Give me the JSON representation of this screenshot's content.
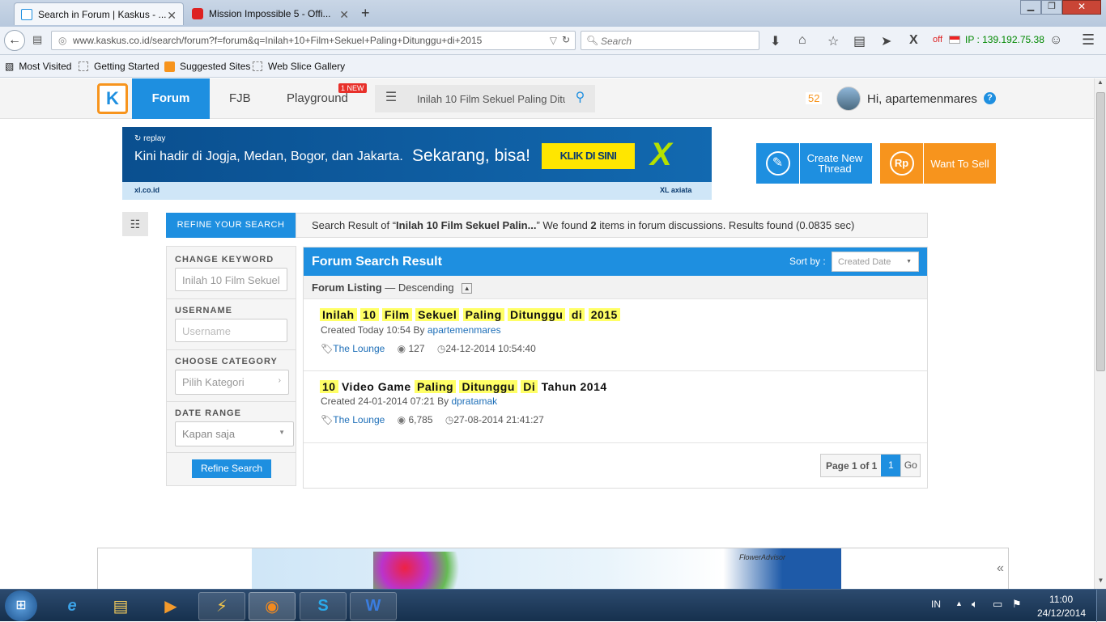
{
  "browser": {
    "tabs": [
      {
        "title": "Search in Forum | Kaskus - ...",
        "active": true
      },
      {
        "title": "Mission Impossible 5 - Offi...",
        "active": false
      }
    ],
    "new_tab_label": "+",
    "url": "www.kaskus.co.id/search/forum?f=forum&q=Inilah+10+Film+Sekuel+Paling+Ditunggu+di+2015",
    "search_placeholder": "Search",
    "vpn_status": "off",
    "ip_label": "IP : 139.192.75.38",
    "bookmarks": [
      "Most Visited",
      "Getting Started",
      "Suggested Sites",
      "Web Slice Gallery"
    ]
  },
  "site": {
    "nav": {
      "forum": "Forum",
      "fjb": "FJB",
      "playground": "Playground",
      "new_badge": "1 NEW",
      "search_value": "Inilah 10 Film Sekuel Paling Ditu"
    },
    "notification_count": "52",
    "greeting": "Hi, apartemenmares",
    "help_icon": "?"
  },
  "banner": {
    "brand_small": "replay",
    "headline": "Kini hadir di Jogja, Medan, Bogor, dan Jakarta.",
    "headline_big": "Sekarang, bisa!",
    "cta": "KLIK DI SINI",
    "site": "xl.co.id",
    "sponsor": "XL axiata"
  },
  "actions": {
    "create_thread": "Create New Thread",
    "want_to_sell": "Want To Sell",
    "rp_icon": "Rp"
  },
  "refine": {
    "tab_label": "REFINE YOUR SEARCH",
    "change_keyword_label": "CHANGE KEYWORD",
    "keyword_value": "Inilah 10 Film Sekuel",
    "username_label": "USERNAME",
    "username_placeholder": "Username",
    "category_label": "CHOOSE CATEGORY",
    "category_value": "Pilih Kategori",
    "date_label": "DATE RANGE",
    "date_value": "Kapan saja",
    "button": "Refine Search"
  },
  "summary": {
    "prefix": "Search Result of “",
    "query": "Inilah 10 Film Sekuel Palin...",
    "middle": "” We found ",
    "count": "2",
    "suffix": " items in forum discussions. Results found (0.0835 sec)"
  },
  "results_panel": {
    "title": "Forum Search Result",
    "sort_label": "Sort by :",
    "sort_value": "Created Date",
    "listing_label": "Forum Listing",
    "listing_order": "— Descending"
  },
  "results": [
    {
      "title_words": [
        {
          "w": "Inilah",
          "hl": true
        },
        {
          "w": "10",
          "hl": true
        },
        {
          "w": "Film",
          "hl": true
        },
        {
          "w": "Sekuel",
          "hl": true
        },
        {
          "w": "Paling",
          "hl": true
        },
        {
          "w": "Ditunggu",
          "hl": true
        },
        {
          "w": "di",
          "hl": true
        },
        {
          "w": "2015",
          "hl": true
        }
      ],
      "created": "Created Today 10:54 By",
      "author": "apartemenmares",
      "category": "The Lounge",
      "views": "127",
      "last_post": "24-12-2014 10:54:40"
    },
    {
      "title_words": [
        {
          "w": "10",
          "hl": true
        },
        {
          "w": "Video",
          "hl": false
        },
        {
          "w": "Game",
          "hl": false
        },
        {
          "w": "Paling",
          "hl": true
        },
        {
          "w": "Ditunggu",
          "hl": true
        },
        {
          "w": "Di",
          "hl": true
        },
        {
          "w": "Tahun",
          "hl": false
        },
        {
          "w": "2014",
          "hl": false
        }
      ],
      "created": "Created 24-01-2014 07:21 By",
      "author": "dpratamak",
      "category": "The Lounge",
      "views": "6,785",
      "last_post": "27-08-2014 21:41:27"
    }
  ],
  "pagination": {
    "label": "Page 1 of 1",
    "current": "1",
    "go": "Go"
  },
  "bottom_ad": {
    "brand": "FlowerAdvisor"
  },
  "taskbar": {
    "lang": "IN",
    "time": "11:00",
    "date": "24/12/2014"
  },
  "colors": {
    "kaskus_blue": "#1e8fe0",
    "orange": "#f7941d",
    "highlight": "#ffff66"
  }
}
